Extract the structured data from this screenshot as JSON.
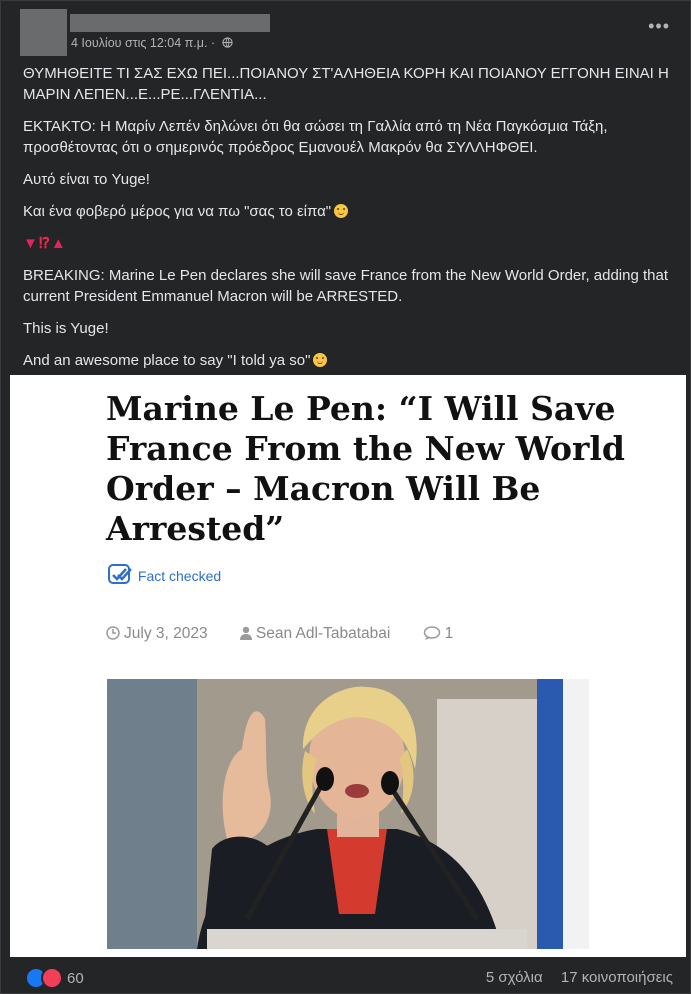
{
  "post": {
    "timestamp": "4 Ιουλίου στις 12:04 π.μ.",
    "paragraphs": [
      "ΘΥΜΗΘΕΙΤΕ ΤΙ ΣΑΣ ΕΧΩ ΠΕΙ...ΠΟΙΑΝΟΥ ΣΤ'ΑΛΗΘΕΙΑ ΚΟΡΗ ΚΑΙ ΠΟΙΑΝΟΥ ΕΓΓΟΝΗ ΕΙΝΑΙ Η ΜΑΡΙΝ ΛΕΠΕΝ...Ε...ΡΕ...ΓΛΕΝΤΙΑ...",
      "ΕΚΤΑΚΤΟ: Η Μαρίν Λεπέν δηλώνει ότι θα σώσει τη Γαλλία από τη Νέα Παγκόσμια Τάξη, προσθέτοντας ότι ο σημερινός πρόεδρος Εμανουέλ Μακρόν θα ΣΥΛΛΗΦΘΕΙ.",
      "Αυτό είναι το Yuge!",
      "Και ένα φοβερό μέρος για να πω \"σας το είπα\"",
      "",
      "BREAKING: Marine Le Pen declares she will save France from the New World Order, adding that current President Emmanuel Macron will be ARRESTED.",
      "This is Yuge!",
      "And an awesome place to say \"I told ya so\"",
      ""
    ],
    "marks": {
      "ex": "⁉"
    }
  },
  "article": {
    "headline": "Marine Le Pen: “I Will Save France From the New World Order – Macron Will Be Arrested”",
    "fact_checked": "Fact checked",
    "date": "July 3, 2023",
    "author": "Sean Adl-Tabatabai",
    "comments": "1"
  },
  "footer": {
    "reaction_count": "60",
    "comments": "5 σχόλια",
    "shares": "17 κοινοποιήσεις"
  },
  "colors": {
    "background": "#242526",
    "link_blue": "#2f6fc8",
    "like": "#1877f2",
    "love": "#f33e58"
  },
  "icons": [
    "more-options-icon",
    "globe-icon",
    "check-icon",
    "clock-icon",
    "user-icon",
    "comment-icon",
    "like-reaction-icon",
    "love-reaction-icon"
  ]
}
